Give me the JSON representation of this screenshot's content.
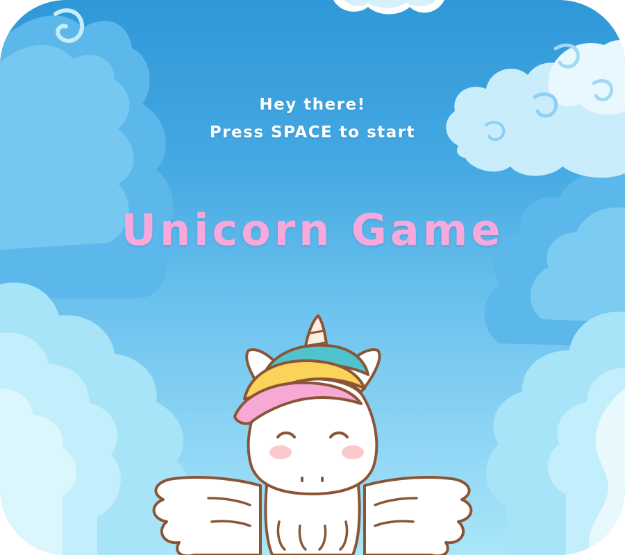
{
  "screen": "title",
  "intro": {
    "greeting": "Hey there!",
    "prompt": "Press SPACE to start"
  },
  "title": "Unicorn Game",
  "colors": {
    "sky_top": "#2f98d8",
    "sky_bottom": "#a9e6f8",
    "title_pink": "#f7a8dc",
    "text_white": "#ffffff",
    "outline_brown": "#8a5536"
  },
  "character": {
    "name": "unicorn",
    "expression": "happy"
  }
}
